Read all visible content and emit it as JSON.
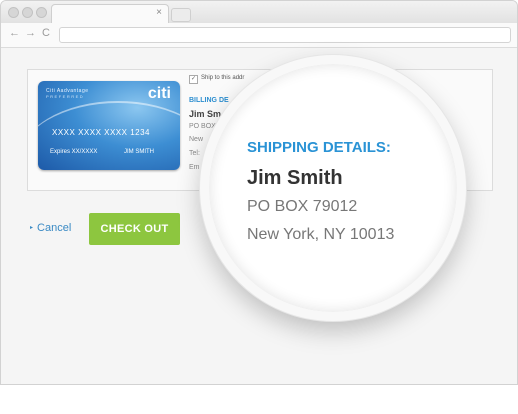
{
  "browser": {
    "tab_close": "×",
    "nav_back": "←",
    "nav_forward": "→",
    "nav_reload": "C"
  },
  "card": {
    "brand": "Citi Aadvantage",
    "tier": "PREFERRED",
    "logo": "citi",
    "number": "XXXX XXXX XXXX 1234",
    "expires": "Expires XX/XXXX",
    "holder": "JIM SMITH"
  },
  "shipping_option": {
    "checkbox_mark": "✓",
    "label": "Ship to this addr"
  },
  "billing": {
    "title": "BILLING DE",
    "name": "Jim Sm",
    "lines": [
      "PO BOX",
      "New",
      "Tel:",
      "Em"
    ]
  },
  "actions": {
    "cancel_label": "Cancel",
    "cancel_arrow": "▸",
    "checkout_label": "CHECK OUT"
  },
  "magnifier": {
    "title": "SHIPPING DETAILS:",
    "name": "Jim Smith",
    "address_line1": "PO BOX 79012",
    "address_line2": "New York, NY 10013"
  },
  "colors": {
    "accent_blue": "#2a93d5",
    "checkout_green": "#8dc63f"
  }
}
